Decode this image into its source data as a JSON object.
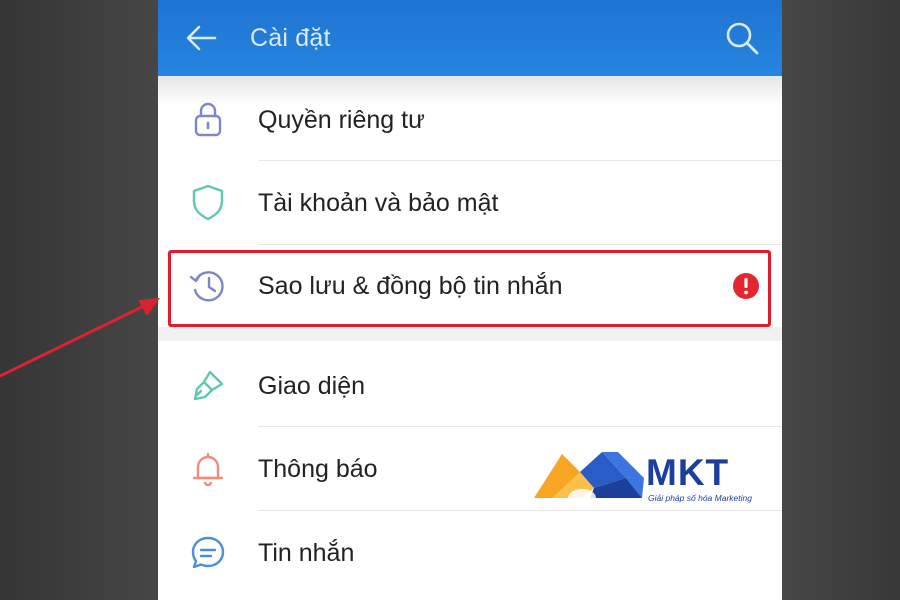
{
  "header": {
    "title": "Cài đặt",
    "back_icon": "back-arrow-icon",
    "search_icon": "search-icon"
  },
  "settings": {
    "items": [
      {
        "label": "Quyền riêng tư",
        "icon": "lock-icon"
      },
      {
        "label": "Tài khoản và bảo mật",
        "icon": "shield-icon"
      },
      {
        "label": "Sao lưu & đồng bộ tin nhắn",
        "icon": "history-icon",
        "badge_icon": "alert-icon",
        "highlighted": true
      },
      {
        "label": "Giao diện",
        "icon": "paint-brush-icon"
      },
      {
        "label": "Thông báo",
        "icon": "bell-icon"
      },
      {
        "label": "Tin nhắn",
        "icon": "chat-bubble-icon"
      }
    ]
  },
  "watermark": {
    "name": "MKT",
    "tagline": "Giải pháp số hóa Marketing"
  },
  "colors": {
    "header_blue": "#1f73d1",
    "highlight_red": "#e01b2a",
    "alert_red": "#e3262f",
    "icon_lavender": "#7d86c9",
    "icon_teal": "#5fc7ae",
    "icon_salmon": "#f08b7d",
    "icon_blue": "#4a8fd8"
  }
}
